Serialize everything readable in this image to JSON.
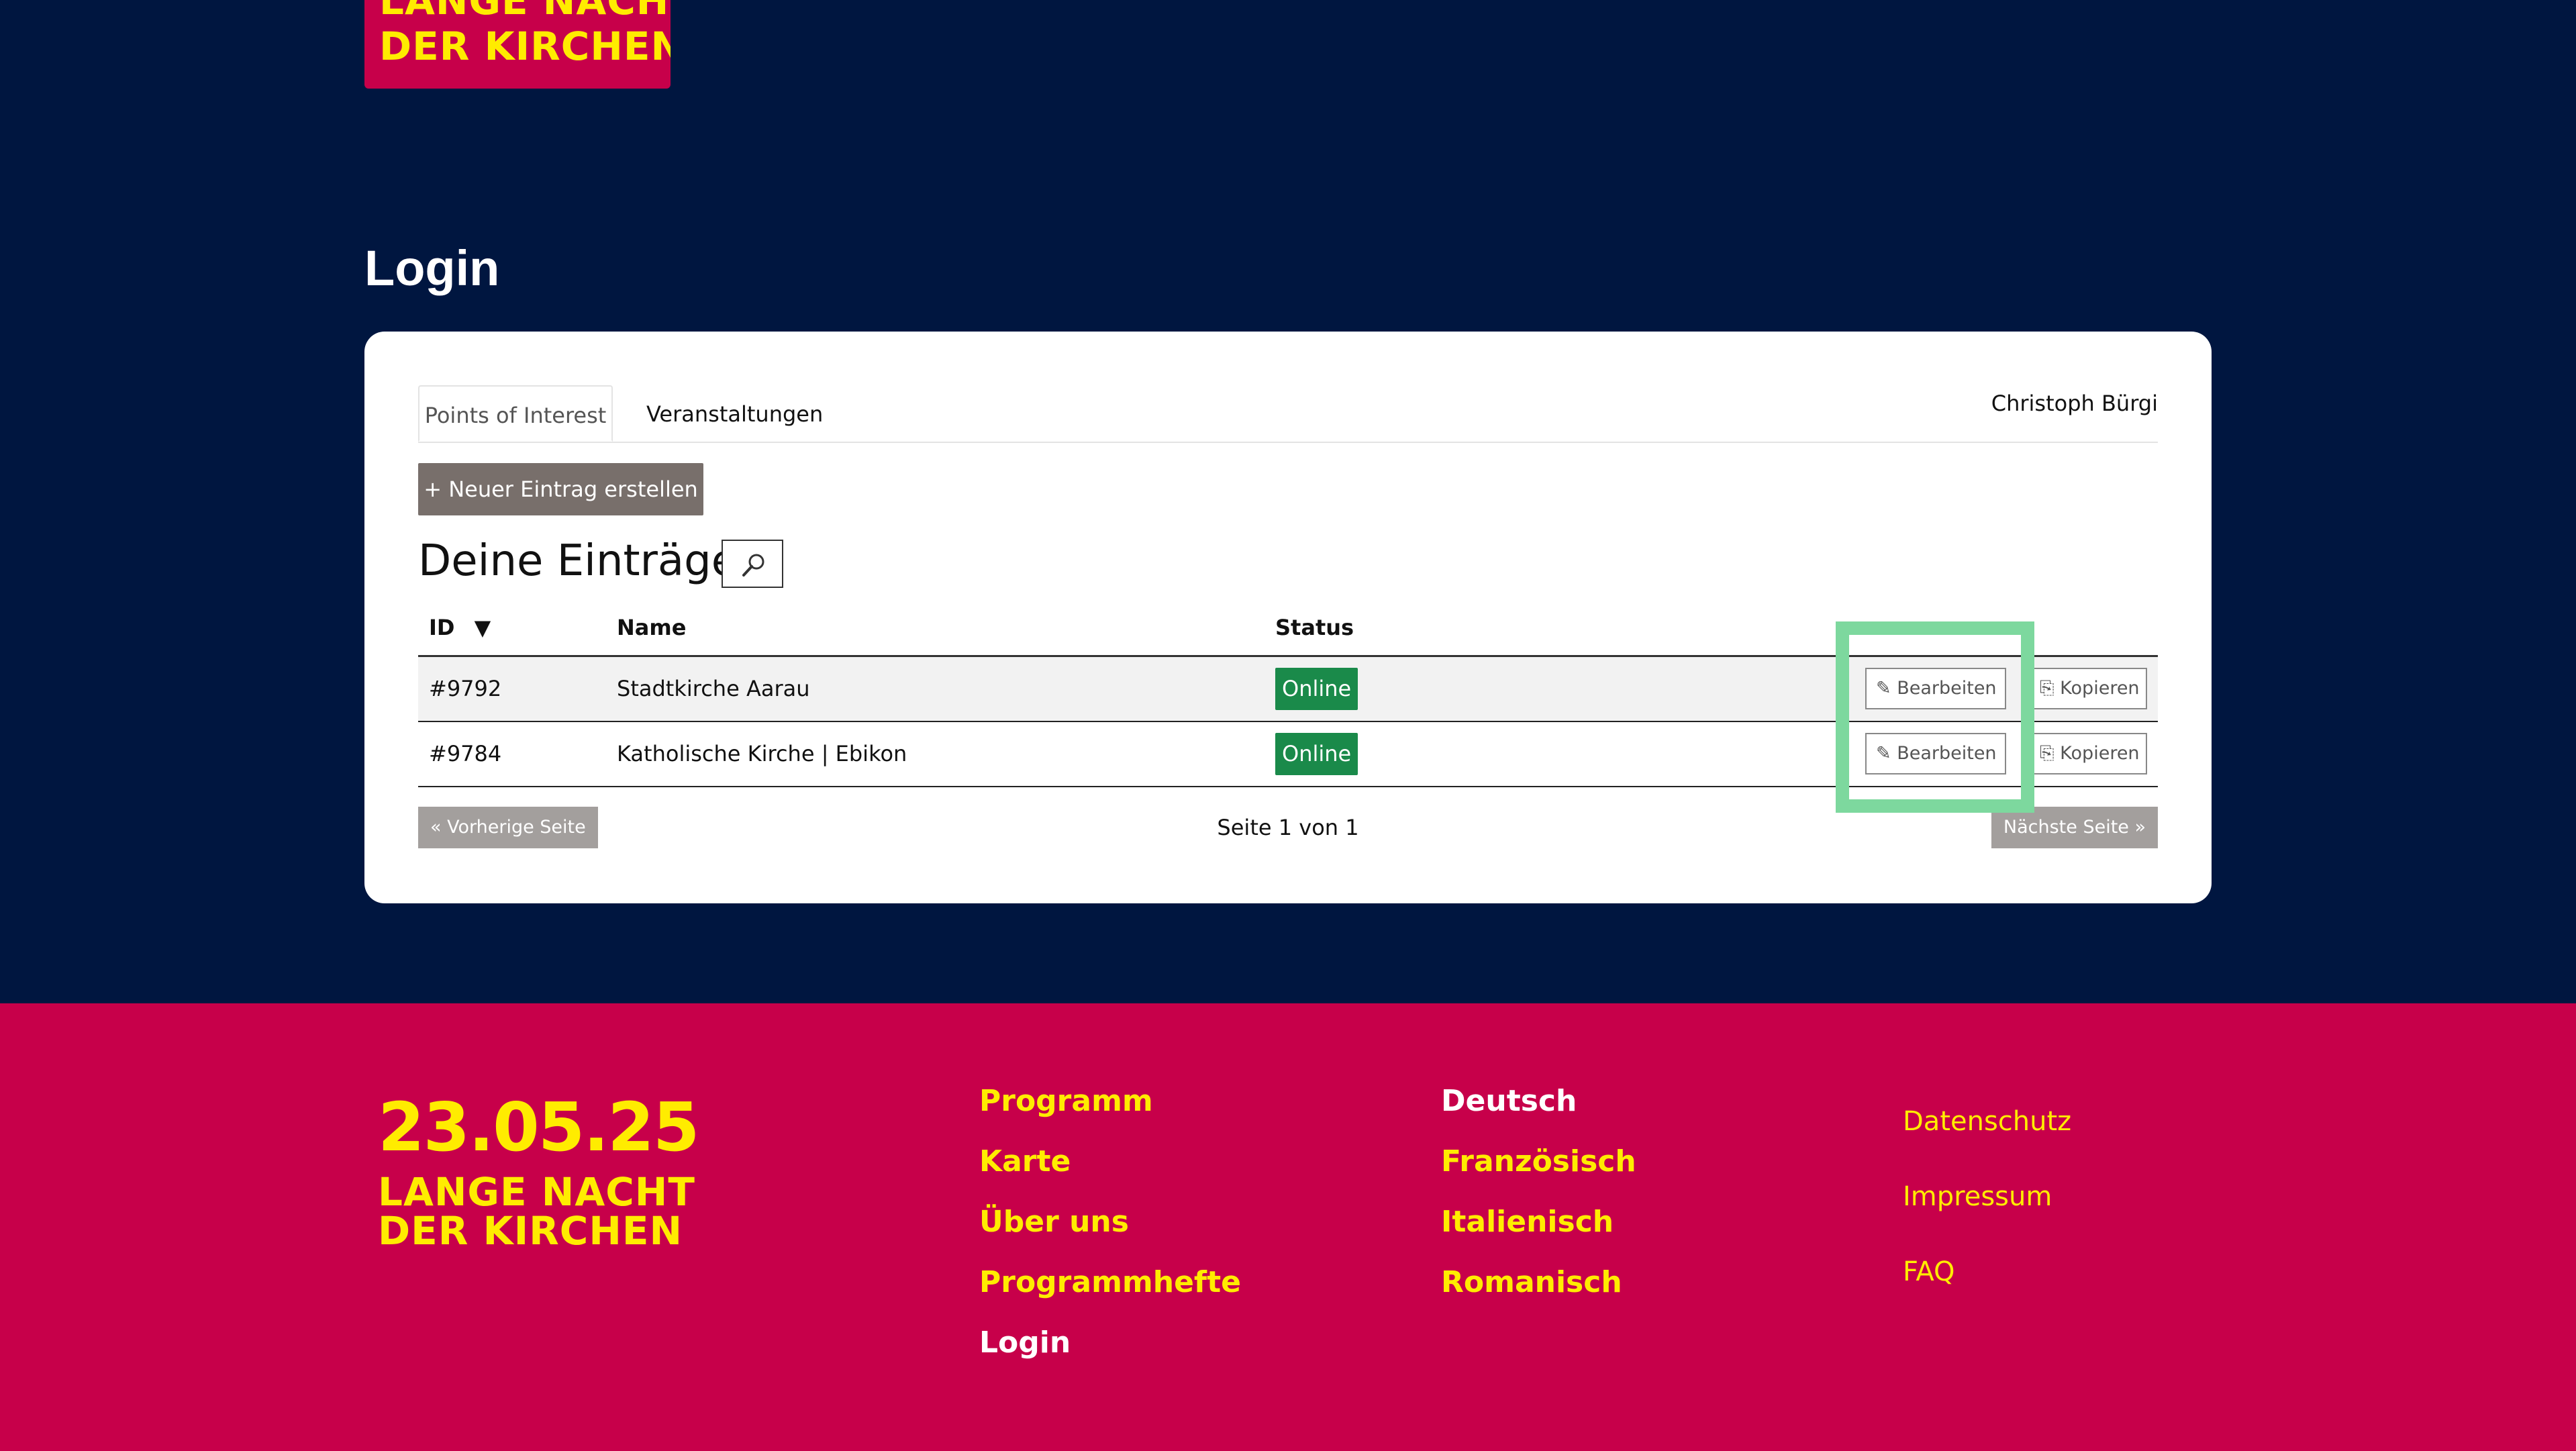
{
  "logo": {
    "line1": "LANGE NACHT",
    "line2": "DER KIRCHEN"
  },
  "page": {
    "title": "Login"
  },
  "tabs": [
    {
      "label": "Points of Interest",
      "active": true
    },
    {
      "label": "Veranstaltungen",
      "active": false
    }
  ],
  "user": {
    "name": "Christoph Bürgi"
  },
  "toolbar": {
    "new_entry_label": "+ Neuer Eintrag erstellen",
    "search_icon": "magnifier-icon"
  },
  "entries": {
    "heading": "Deine Einträge",
    "columns": {
      "id": "ID",
      "sort_indicator": "▼",
      "name": "Name",
      "status": "Status"
    },
    "rows": [
      {
        "id": "#9792",
        "name": "Stadtkirche Aarau",
        "status": "Online",
        "edit_label": "✎ Bearbeiten",
        "copy_label": "⎘ Kopieren"
      },
      {
        "id": "#9784",
        "name": "Katholische Kirche | Ebikon",
        "status": "Online",
        "edit_label": "✎ Bearbeiten",
        "copy_label": "⎘ Kopieren"
      }
    ]
  },
  "pagination": {
    "prev_label": "« Vorherige Seite",
    "page_info": "Seite 1 von 1",
    "next_label": "Nächste Seite »"
  },
  "footer": {
    "date": "23.05.25",
    "title_line1": "LANGE NACHT",
    "title_line2": "DER KIRCHEN",
    "nav": [
      "Programm",
      "Karte",
      "Über uns",
      "Programmhefte",
      "Login"
    ],
    "languages": [
      "Deutsch",
      "Französisch",
      "Italienisch",
      "Romanisch"
    ],
    "legal": [
      "Datenschutz",
      "Impressum",
      "FAQ"
    ]
  },
  "colors": {
    "background": "#001640",
    "brand_red": "#c7004a",
    "brand_yellow": "#ffec00",
    "status_online": "#1a8a4a",
    "highlight": "#7dd89e"
  }
}
